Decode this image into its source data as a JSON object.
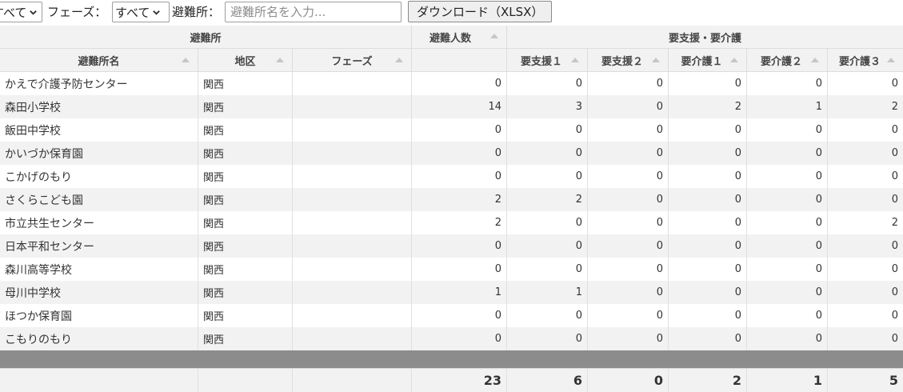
{
  "toolbar": {
    "district_select_value": "すべて",
    "phase_label": "フェーズ：",
    "phase_select_value": "すべて",
    "shelter_label": "避難所：",
    "search_placeholder": "避難所名を入力...",
    "download_label": "ダウンロード（XLSX）"
  },
  "table": {
    "group_headers": {
      "shelter": "避難所",
      "evacuees": "避難人数",
      "care": "要支援・要介護"
    },
    "columns": {
      "name": "避難所名",
      "district": "地区",
      "phase": "フェーズ",
      "support1": "要支援１",
      "support2": "要支援２",
      "care1": "要介護１",
      "care2": "要介護２",
      "care3": "要介護３"
    },
    "rows": [
      {
        "name": "かえで介護予防センター",
        "district": "関西",
        "phase": "",
        "evacuees": "0",
        "s1": "0",
        "s2": "0",
        "c1": "0",
        "c2": "0",
        "c3": "0"
      },
      {
        "name": "森田小学校",
        "district": "関西",
        "phase": "",
        "evacuees": "14",
        "s1": "3",
        "s2": "0",
        "c1": "2",
        "c2": "1",
        "c3": "2"
      },
      {
        "name": "飯田中学校",
        "district": "関西",
        "phase": "",
        "evacuees": "0",
        "s1": "0",
        "s2": "0",
        "c1": "0",
        "c2": "0",
        "c3": "0"
      },
      {
        "name": "かいづか保育園",
        "district": "関西",
        "phase": "",
        "evacuees": "0",
        "s1": "0",
        "s2": "0",
        "c1": "0",
        "c2": "0",
        "c3": "0"
      },
      {
        "name": "こかげのもり",
        "district": "関西",
        "phase": "",
        "evacuees": "0",
        "s1": "0",
        "s2": "0",
        "c1": "0",
        "c2": "0",
        "c3": "0"
      },
      {
        "name": "さくらこども園",
        "district": "関西",
        "phase": "",
        "evacuees": "2",
        "s1": "2",
        "s2": "0",
        "c1": "0",
        "c2": "0",
        "c3": "0"
      },
      {
        "name": "市立共生センター",
        "district": "関西",
        "phase": "",
        "evacuees": "2",
        "s1": "0",
        "s2": "0",
        "c1": "0",
        "c2": "0",
        "c3": "2"
      },
      {
        "name": "日本平和センター",
        "district": "関西",
        "phase": "",
        "evacuees": "0",
        "s1": "0",
        "s2": "0",
        "c1": "0",
        "c2": "0",
        "c3": "0"
      },
      {
        "name": "森川高等学校",
        "district": "関西",
        "phase": "",
        "evacuees": "0",
        "s1": "0",
        "s2": "0",
        "c1": "0",
        "c2": "0",
        "c3": "0"
      },
      {
        "name": "母川中学校",
        "district": "関西",
        "phase": "",
        "evacuees": "1",
        "s1": "1",
        "s2": "0",
        "c1": "0",
        "c2": "0",
        "c3": "0"
      },
      {
        "name": "ほつか保育園",
        "district": "関西",
        "phase": "",
        "evacuees": "0",
        "s1": "0",
        "s2": "0",
        "c1": "0",
        "c2": "0",
        "c3": "0"
      },
      {
        "name": "こもりのもり",
        "district": "関西",
        "phase": "",
        "evacuees": "0",
        "s1": "0",
        "s2": "0",
        "c1": "0",
        "c2": "0",
        "c3": "0"
      }
    ],
    "totals": {
      "evacuees": "23",
      "s1": "6",
      "s2": "0",
      "c1": "2",
      "c2": "1",
      "c3": "5"
    }
  }
}
